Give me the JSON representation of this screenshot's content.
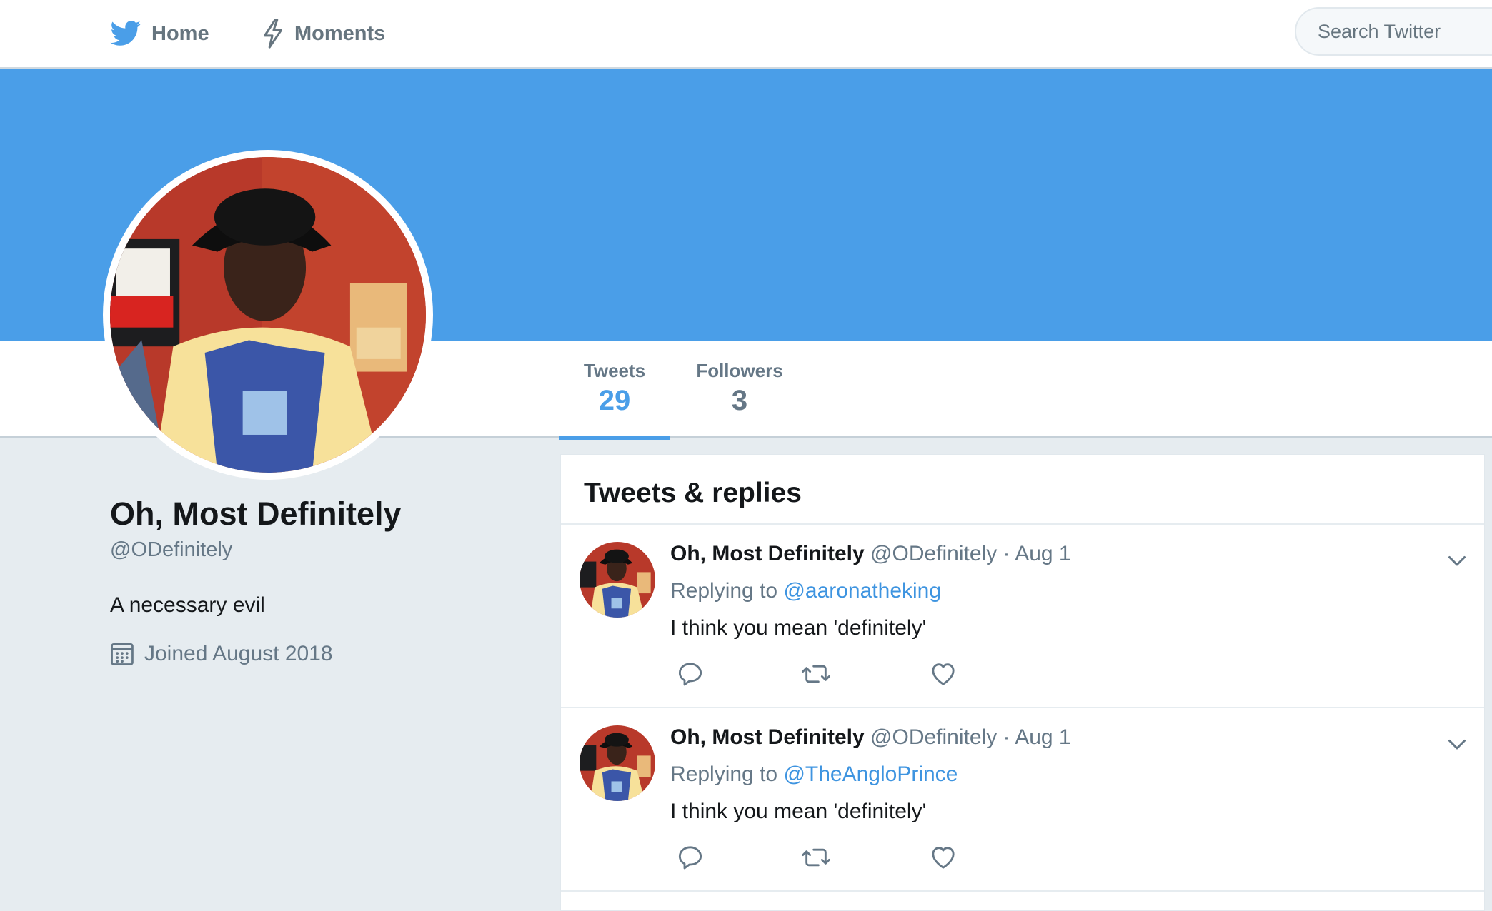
{
  "nav": {
    "home_label": "Home",
    "moments_label": "Moments",
    "search_placeholder": "Search Twitter",
    "home_icon": "twitter-bird-icon",
    "moments_icon": "lightning-icon"
  },
  "colors": {
    "brand_blue": "#4a9ee8",
    "link_blue": "#3e94e0",
    "muted_text": "#657786",
    "background": "#e6ecf0"
  },
  "profile_nav": {
    "tweets_label": "Tweets",
    "tweets_count": "29",
    "followers_label": "Followers",
    "followers_count": "3",
    "active_tab": "Tweets"
  },
  "profile": {
    "name": "Oh, Most Definitely",
    "handle": "@ODefinitely",
    "bio": "A necessary evil",
    "joined": "Joined August 2018",
    "joined_icon": "calendar-icon"
  },
  "timeline": {
    "title": "Tweets & replies",
    "tweets": [
      {
        "name": "Oh, Most Definitely",
        "meta": "@ODefinitely · Aug 1",
        "replying_prefix": "Replying to",
        "replying_to": "@aaronatheking",
        "text": "I think you mean 'definitely'"
      },
      {
        "name": "Oh, Most Definitely",
        "meta": "@ODefinitely · Aug 1",
        "replying_prefix": "Replying to",
        "replying_to": "@TheAngloPrince",
        "text": "I think you mean 'definitely'"
      }
    ]
  }
}
